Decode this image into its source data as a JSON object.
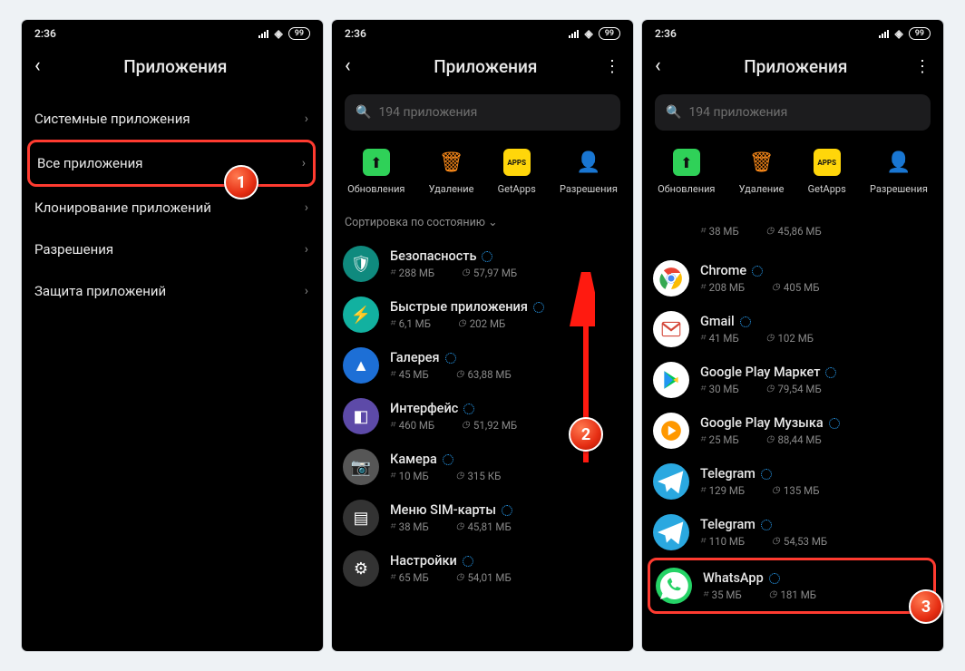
{
  "status": {
    "time": "2:36",
    "battery": "99"
  },
  "header": {
    "title": "Приложения"
  },
  "screen1": {
    "rows": [
      {
        "label": "Системные приложения"
      },
      {
        "label": "Все приложения",
        "highlight": true
      },
      {
        "label": "Клонирование приложений"
      },
      {
        "label": "Разрешения"
      },
      {
        "label": "Защита приложений"
      }
    ]
  },
  "search": {
    "placeholder": "194 приложения"
  },
  "actions": {
    "update": "Обновления",
    "delete": "Удаление",
    "getapps": "GetApps",
    "perms": "Разрешения"
  },
  "sort": {
    "label": "Сортировка по состоянию"
  },
  "screen2_items": [
    {
      "name": "Безопасность",
      "disk": "288 МБ",
      "time": "57,97 МБ",
      "icon": "shield",
      "bg": "bg-teal"
    },
    {
      "name": "Быстрые приложения",
      "disk": "6,1 МБ",
      "time": "202 МБ",
      "icon": "bolt",
      "bg": "bg-teal2"
    },
    {
      "name": "Галерея",
      "disk": "45 МБ",
      "time": "63,88 МБ",
      "icon": "photo",
      "bg": "bg-blue"
    },
    {
      "name": "Интерфейс",
      "disk": "460 МБ",
      "time": "51,92 МБ",
      "icon": "ui",
      "bg": "bg-purple"
    },
    {
      "name": "Камера",
      "disk": "10 МБ",
      "time": "315 КБ",
      "icon": "camera",
      "bg": "bg-grey"
    },
    {
      "name": "Меню SIM-карты",
      "disk": "38 МБ",
      "time": "45,81 МБ",
      "icon": "sim",
      "bg": "bg-dark"
    },
    {
      "name": "Настройки",
      "disk": "65 МБ",
      "time": "54,01 МБ",
      "icon": "gear",
      "bg": "bg-dark"
    }
  ],
  "screen3_partial": {
    "disk": "38 МБ",
    "time": "45,86 МБ"
  },
  "screen3_items": [
    {
      "name": "Chrome",
      "disk": "208 МБ",
      "time": "405 МБ",
      "icon": "chrome",
      "bg": "bg-chrome"
    },
    {
      "name": "Gmail",
      "disk": "41 МБ",
      "time": "102 МБ",
      "icon": "gmail",
      "bg": "bg-gmail"
    },
    {
      "name": "Google Play Маркет",
      "disk": "30 МБ",
      "time": "79,54 МБ",
      "icon": "play",
      "bg": "bg-play"
    },
    {
      "name": "Google Play Музыка",
      "disk": "25 МБ",
      "time": "88,44 МБ",
      "icon": "music",
      "bg": "bg-music"
    },
    {
      "name": "Telegram",
      "disk": "129 МБ",
      "time": "135 МБ",
      "icon": "tg",
      "bg": "bg-tg"
    },
    {
      "name": "Telegram",
      "disk": "110 МБ",
      "time": "54,53 МБ",
      "icon": "tg",
      "bg": "bg-tg"
    },
    {
      "name": "WhatsApp",
      "disk": "35 МБ",
      "time": "181 МБ",
      "icon": "wa",
      "bg": "bg-wa",
      "highlight": true
    }
  ],
  "badges": {
    "b1": "1",
    "b2": "2",
    "b3": "3"
  },
  "glyph": {
    "back": "‹",
    "kebab": "⋮",
    "chev": "›",
    "search": "🔍",
    "upload": "⬆",
    "trash": "🗑",
    "apps": "APPS",
    "perm": "👤",
    "dropdown": "⌄",
    "disk": "⌗",
    "clock": "◷"
  }
}
